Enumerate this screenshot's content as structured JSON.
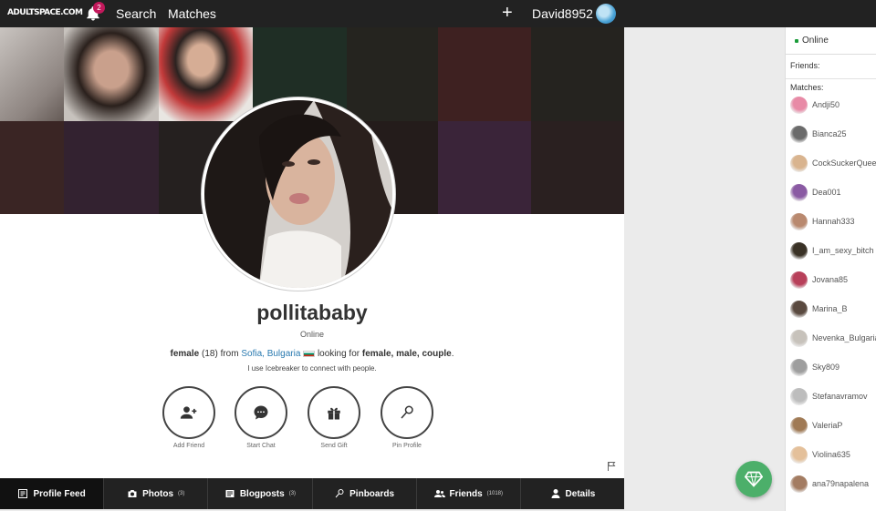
{
  "topbar": {
    "logo": "ADULTSPACE.COM",
    "notification_count": "2",
    "search_label": "Search",
    "matches_label": "Matches",
    "username": "David8952"
  },
  "profile": {
    "username": "pollitababy",
    "status": "Online",
    "gender": "female",
    "age": "(18)",
    "from_word": "from",
    "city": "Sofia, Bulgaria",
    "looking_word": "looking for",
    "looking_for": "female, male, couple",
    "tagline": "I use Icebreaker to connect with people."
  },
  "actions": [
    {
      "label": "Add Friend",
      "icon": "add-friend-icon"
    },
    {
      "label": "Start Chat",
      "icon": "chat-icon"
    },
    {
      "label": "Send Gift",
      "icon": "gift-icon"
    },
    {
      "label": "Pin Profile",
      "icon": "pin-icon"
    }
  ],
  "tabs": [
    {
      "label": "Profile Feed",
      "count": "",
      "icon": "feed-icon"
    },
    {
      "label": "Photos",
      "count": "(3)",
      "icon": "camera-icon"
    },
    {
      "label": "Blogposts",
      "count": "(3)",
      "icon": "blog-icon"
    },
    {
      "label": "Pinboards",
      "count": "",
      "icon": "pin-icon"
    },
    {
      "label": "Friends",
      "count": "(1018)",
      "icon": "friends-icon"
    },
    {
      "label": "Details",
      "count": "",
      "icon": "person-icon"
    }
  ],
  "sidebar": {
    "online_label": "Online",
    "friends_label": "Friends:",
    "matches_label": "Matches:",
    "matches": [
      {
        "name": "Andji50",
        "color": "#e88aa6"
      },
      {
        "name": "Bianca25",
        "color": "#6b6b6b"
      },
      {
        "name": "CockSuckerQueen",
        "color": "#d9b48f"
      },
      {
        "name": "Dea001",
        "color": "#8a5aa3"
      },
      {
        "name": "Hannah333",
        "color": "#b9896f"
      },
      {
        "name": "I_am_sexy_bitch",
        "color": "#3a3226"
      },
      {
        "name": "Jovana85",
        "color": "#b8405a"
      },
      {
        "name": "Marina_B",
        "color": "#5a4a40"
      },
      {
        "name": "Nevenka_Bulgaria",
        "color": "#c7c2bb"
      },
      {
        "name": "Sky809",
        "color": "#9e9e9e"
      },
      {
        "name": "Stefanavramov",
        "color": "#bdbdbd"
      },
      {
        "name": "ValeriaP",
        "color": "#a07a55"
      },
      {
        "name": "Violina635",
        "color": "#e4c09a"
      },
      {
        "name": "ana79napalena",
        "color": "#a37c62"
      }
    ]
  },
  "colors": {
    "topbar_bg": "#222222",
    "badge": "#c2185b",
    "link": "#2a7ab0",
    "gem_button": "#4caf6a",
    "online_dot": "#1b9c3a"
  }
}
